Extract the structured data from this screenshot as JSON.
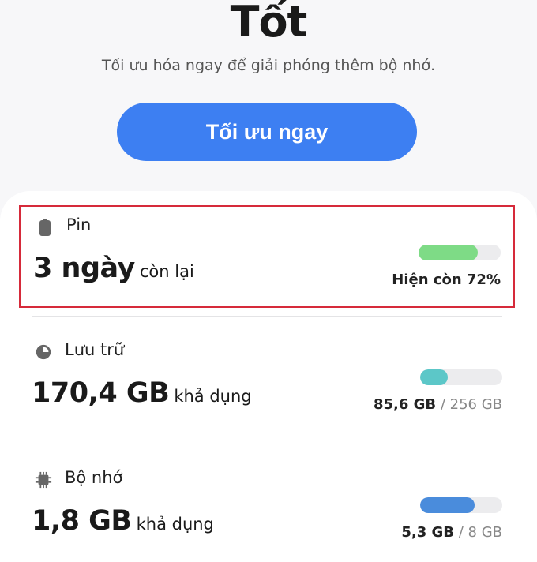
{
  "header": {
    "status": "Tốt",
    "subtitle": "Tối ưu hóa ngay để giải phóng thêm bộ nhớ.",
    "optimize_label": "Tối ưu ngay"
  },
  "battery": {
    "label": "Pin",
    "value": "3 ngày",
    "suffix": "còn lại",
    "status": "Hiện còn 72%",
    "percent": 72,
    "bar_color": "#7edb86",
    "icon": "battery-icon"
  },
  "storage": {
    "label": "Lưu trữ",
    "value": "170,4 GB",
    "suffix": "khả dụng",
    "used": "85,6 GB",
    "separator": " / ",
    "total": "256 GB",
    "percent": 33.4,
    "bar_color": "#5cc7c8",
    "icon": "storage-pie-icon"
  },
  "memory": {
    "label": "Bộ nhớ",
    "value": "1,8 GB",
    "suffix": "khả dụng",
    "used": "5,3 GB",
    "separator": " / ",
    "total": "8 GB",
    "percent": 66.3,
    "bar_color": "#4a8cdc",
    "icon": "memory-chip-icon"
  }
}
